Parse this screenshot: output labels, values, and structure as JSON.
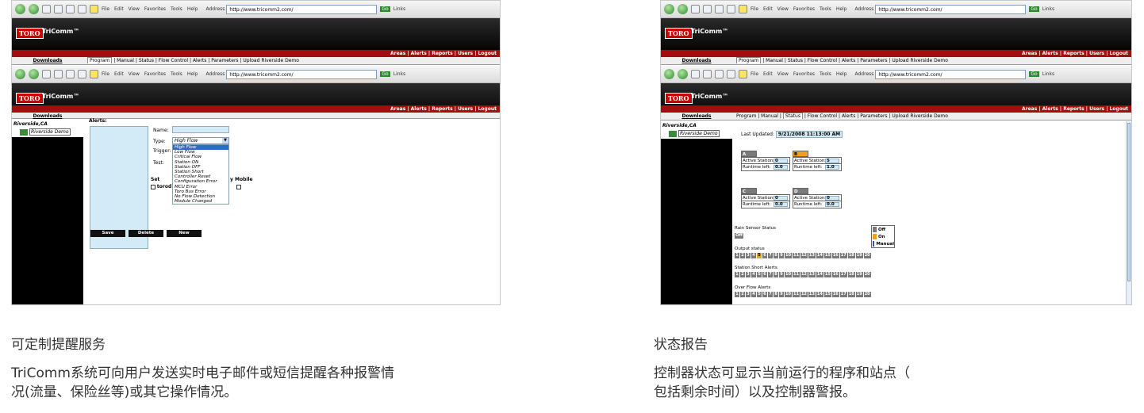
{
  "browser": {
    "menu": [
      "File",
      "Edit",
      "View",
      "Favorites",
      "Tools",
      "Help"
    ],
    "address_label": "Address",
    "address_url": "http://www.tricomm2.com/",
    "go_label": "Go",
    "links_label": "Links"
  },
  "app": {
    "logo": "TORO",
    "name": "TriComm™",
    "top_links": "Areas | Alerts | Reports | Users | Logout",
    "downloads": "Downloads",
    "tabs": [
      "Program",
      "Manual",
      "Status",
      "Flow Control",
      "Alerts",
      "Parameters",
      "Upload"
    ],
    "site_title": "Riverside Demo",
    "tree_root": "Riverside,CA",
    "tree_child": "Riverside Demo"
  },
  "alerts_panel": {
    "heading": "Alerts:",
    "name_label": "Name:",
    "type_label": "Type:",
    "type_value": "High Flow",
    "trigger_label": "Trigger:",
    "test_label": "Test:",
    "set_label": "Set",
    "set_value": "torod",
    "mobile_label": "y Mobile",
    "type_options": [
      "High Flow",
      "Low Flow",
      "Critical Flow",
      "Station ON",
      "Station OFF",
      "Station Short",
      "Controller Reset",
      "Configuration Error",
      "MCU Error",
      "Toro Bus Error",
      "No Flow Detection",
      "Module Changed"
    ],
    "buttons": [
      "Save",
      "Delete",
      "New"
    ]
  },
  "status_panel": {
    "last_updated_label": "Last Updated:",
    "last_updated_value": "9/21/2008 11:13:00 AM",
    "controllers": [
      {
        "id": "A",
        "stations": "0",
        "runtime": "0.0",
        "color": "#7a7a7a"
      },
      {
        "id": "B",
        "stations": "5",
        "runtime": "1.0",
        "color": "#f0a020"
      },
      {
        "id": "C",
        "stations": "0",
        "runtime": "0.0",
        "color": "#7a7a7a"
      },
      {
        "id": "D",
        "stations": "0",
        "runtime": "0.0",
        "color": "#7a7a7a"
      }
    ],
    "active_label": "Active Stations:",
    "runtime_label": "Runtime left:",
    "rain_label": "Rain Sensor Status",
    "rain_value": "Off",
    "legend": [
      "Off",
      "On",
      "Manual"
    ],
    "output_label": "Output status",
    "short_label": "Station Short Alerts",
    "overflow_label": "Over Flow Alerts",
    "numbers": [
      "1",
      "2",
      "3",
      "4",
      "5",
      "6",
      "7",
      "8",
      "9",
      "10",
      "11",
      "12",
      "13",
      "14",
      "15",
      "16",
      "17",
      "18",
      "19",
      "20"
    ]
  },
  "captions": {
    "left_title": "可定制提醒服务",
    "left_body_1": "TriComm系统可向用户发送实时电子邮件或短信提醒各种报警情",
    "left_body_2": "况(流量、保险丝等)或其它操作情况。",
    "right_title": "状态报告",
    "right_body_1": "控制器状态可显示当前运行的程序和站点（",
    "right_body_2": "包括剩余时间）以及控制器警报。"
  }
}
